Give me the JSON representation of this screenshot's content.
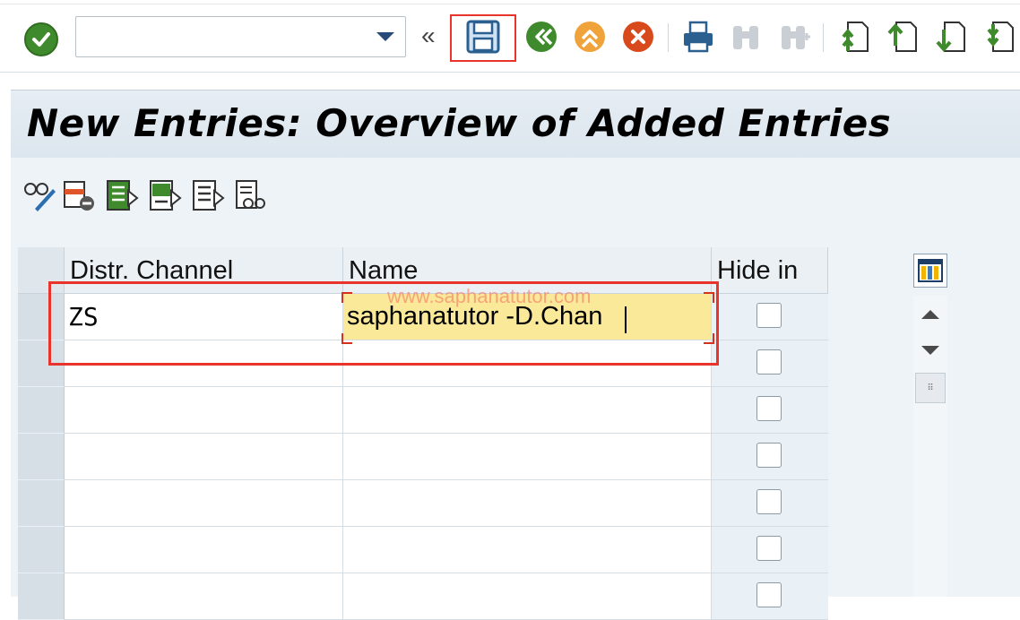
{
  "toolbar": {
    "command_field_value": "",
    "command_field_placeholder": "",
    "collapse_glyph": "«",
    "icons": [
      "check-icon",
      "save-icon",
      "back-icon",
      "exit-icon",
      "cancel-icon",
      "print-icon",
      "find-icon",
      "find-next-icon",
      "first-page-icon",
      "previous-page-icon",
      "next-page-icon",
      "last-page-icon"
    ]
  },
  "title": "New Entries: Overview of Added Entries",
  "app_toolbar": {
    "icons": [
      "display-change-icon",
      "delete-row-icon",
      "select-all-icon",
      "select-block-icon",
      "deselect-all-icon",
      "compare-icon"
    ]
  },
  "table": {
    "columns": [
      "Distr. Channel",
      "Name",
      "Hide in"
    ],
    "rows": [
      {
        "distr_channel": "ZS",
        "name": "saphanatutor -D.Chan",
        "hide_in": false
      },
      {
        "distr_channel": "",
        "name": "",
        "hide_in": false
      },
      {
        "distr_channel": "",
        "name": "",
        "hide_in": false
      },
      {
        "distr_channel": "",
        "name": "",
        "hide_in": false
      },
      {
        "distr_channel": "",
        "name": "",
        "hide_in": false
      },
      {
        "distr_channel": "",
        "name": "",
        "hide_in": false
      },
      {
        "distr_channel": "",
        "name": "",
        "hide_in": false
      }
    ]
  },
  "watermark": "www.saphanatutor.com",
  "colors": {
    "highlight": "#e8342a",
    "active_cell": "#fbe99a",
    "header_bg": "#dce6ee",
    "ok_green": "#3f8a2c"
  }
}
